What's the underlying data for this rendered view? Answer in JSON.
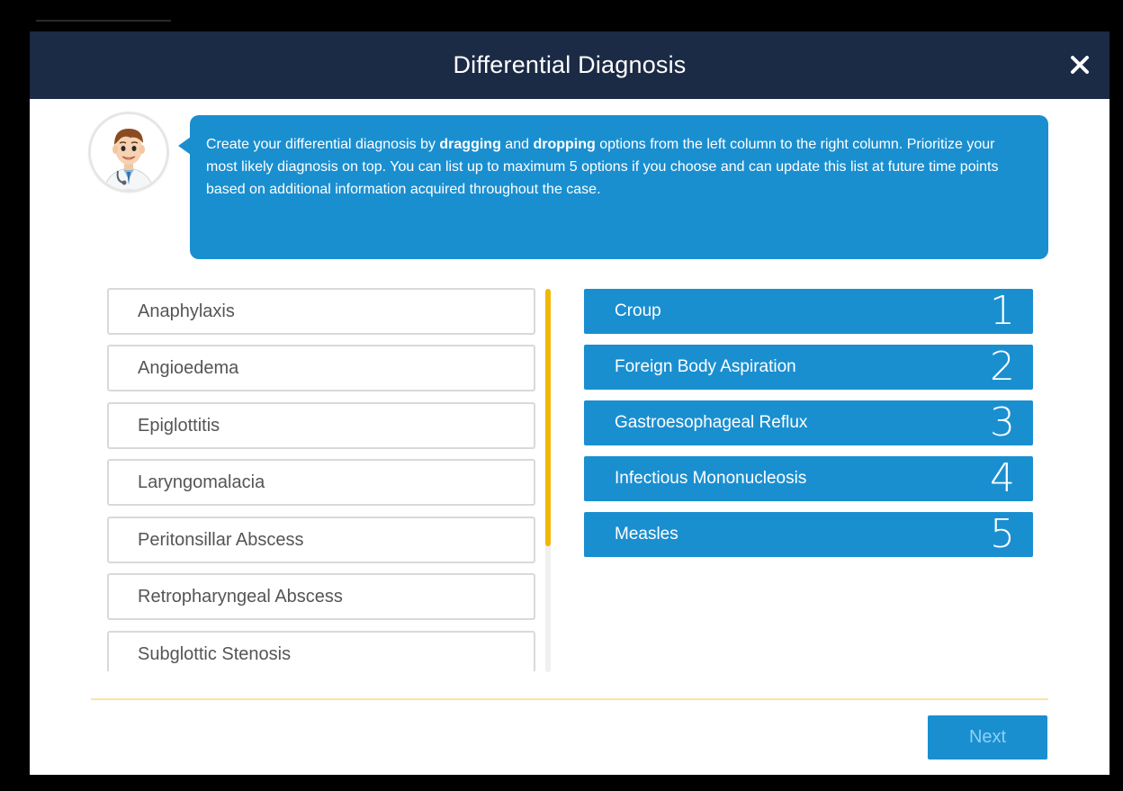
{
  "modal": {
    "title": "Differential Diagnosis",
    "close_icon": "close-icon"
  },
  "instructions": {
    "avatar_icon": "doctor-avatar-icon",
    "part1": "Create your differential diagnosis by ",
    "bold1": "dragging",
    "part2": " and ",
    "bold2": "dropping",
    "part3": " options from the left column to the right column. Prioritize your most likely diagnosis on top. You can list up to maximum 5 options if you choose and can update this list at future time points based on additional information acquired throughout the case."
  },
  "options": [
    {
      "label": "Anaphylaxis"
    },
    {
      "label": "Angioedema"
    },
    {
      "label": "Epiglottitis"
    },
    {
      "label": "Laryngomalacia"
    },
    {
      "label": "Peritonsillar Abscess"
    },
    {
      "label": "Retropharyngeal Abscess"
    },
    {
      "label": "Subglottic Stenosis"
    }
  ],
  "ranked": [
    {
      "label": "Croup",
      "rank": "1"
    },
    {
      "label": "Foreign Body Aspiration",
      "rank": "2"
    },
    {
      "label": "Gastroesophageal Reflux",
      "rank": "3"
    },
    {
      "label": "Infectious Mononucleosis",
      "rank": "4"
    },
    {
      "label": "Measles",
      "rank": "5"
    }
  ],
  "footer": {
    "next_label": "Next"
  },
  "colors": {
    "header_bg": "#1b2a45",
    "accent_blue": "#1a8fd0",
    "scroll_thumb": "#f2b705",
    "divider": "#fbe3a2"
  }
}
